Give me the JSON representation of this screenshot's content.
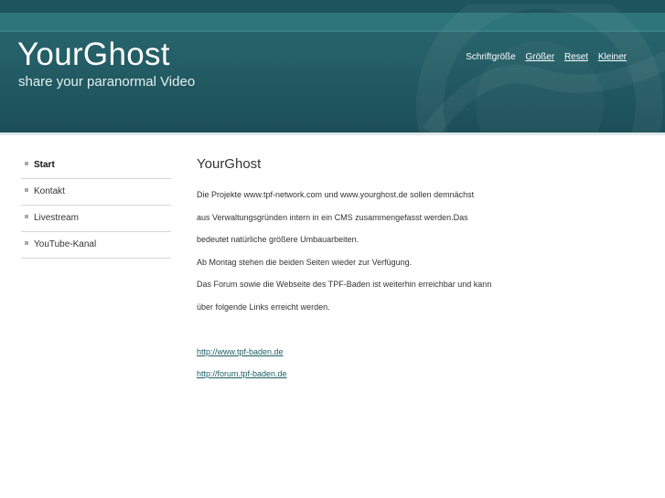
{
  "header": {
    "title": "YourGhost",
    "subtitle": "share your paranormal Video"
  },
  "fontsize": {
    "label": "Schriftgröße",
    "bigger": "Größer",
    "reset": "Reset",
    "smaller": "Kleiner"
  },
  "nav": {
    "items": [
      {
        "label": "Start",
        "active": true
      },
      {
        "label": "Kontakt"
      },
      {
        "label": "Livestream"
      },
      {
        "label": "YouTube-Kanal"
      }
    ]
  },
  "content": {
    "heading": "YourGhost",
    "lines": [
      "Die Projekte www.tpf-network.com und www.yourghost.de sollen demnächst",
      "aus Verwaltungsgründen intern in ein CMS zusammengefasst werden.Das",
      "bedeutet natürliche größere Umbauarbeiten.",
      "Ab Montag stehen die beiden Seiten wieder zur Verfügung.",
      "Das Forum sowie die Webseite des TPF-Baden ist weiterhin erreichbar und kann",
      "über folgende Links erreicht werden."
    ],
    "links": [
      "http://www.tpf-baden.de",
      "http://forum.tpf-baden.de"
    ]
  },
  "colors": {
    "header": "#245e66",
    "link": "#1e5d66"
  }
}
